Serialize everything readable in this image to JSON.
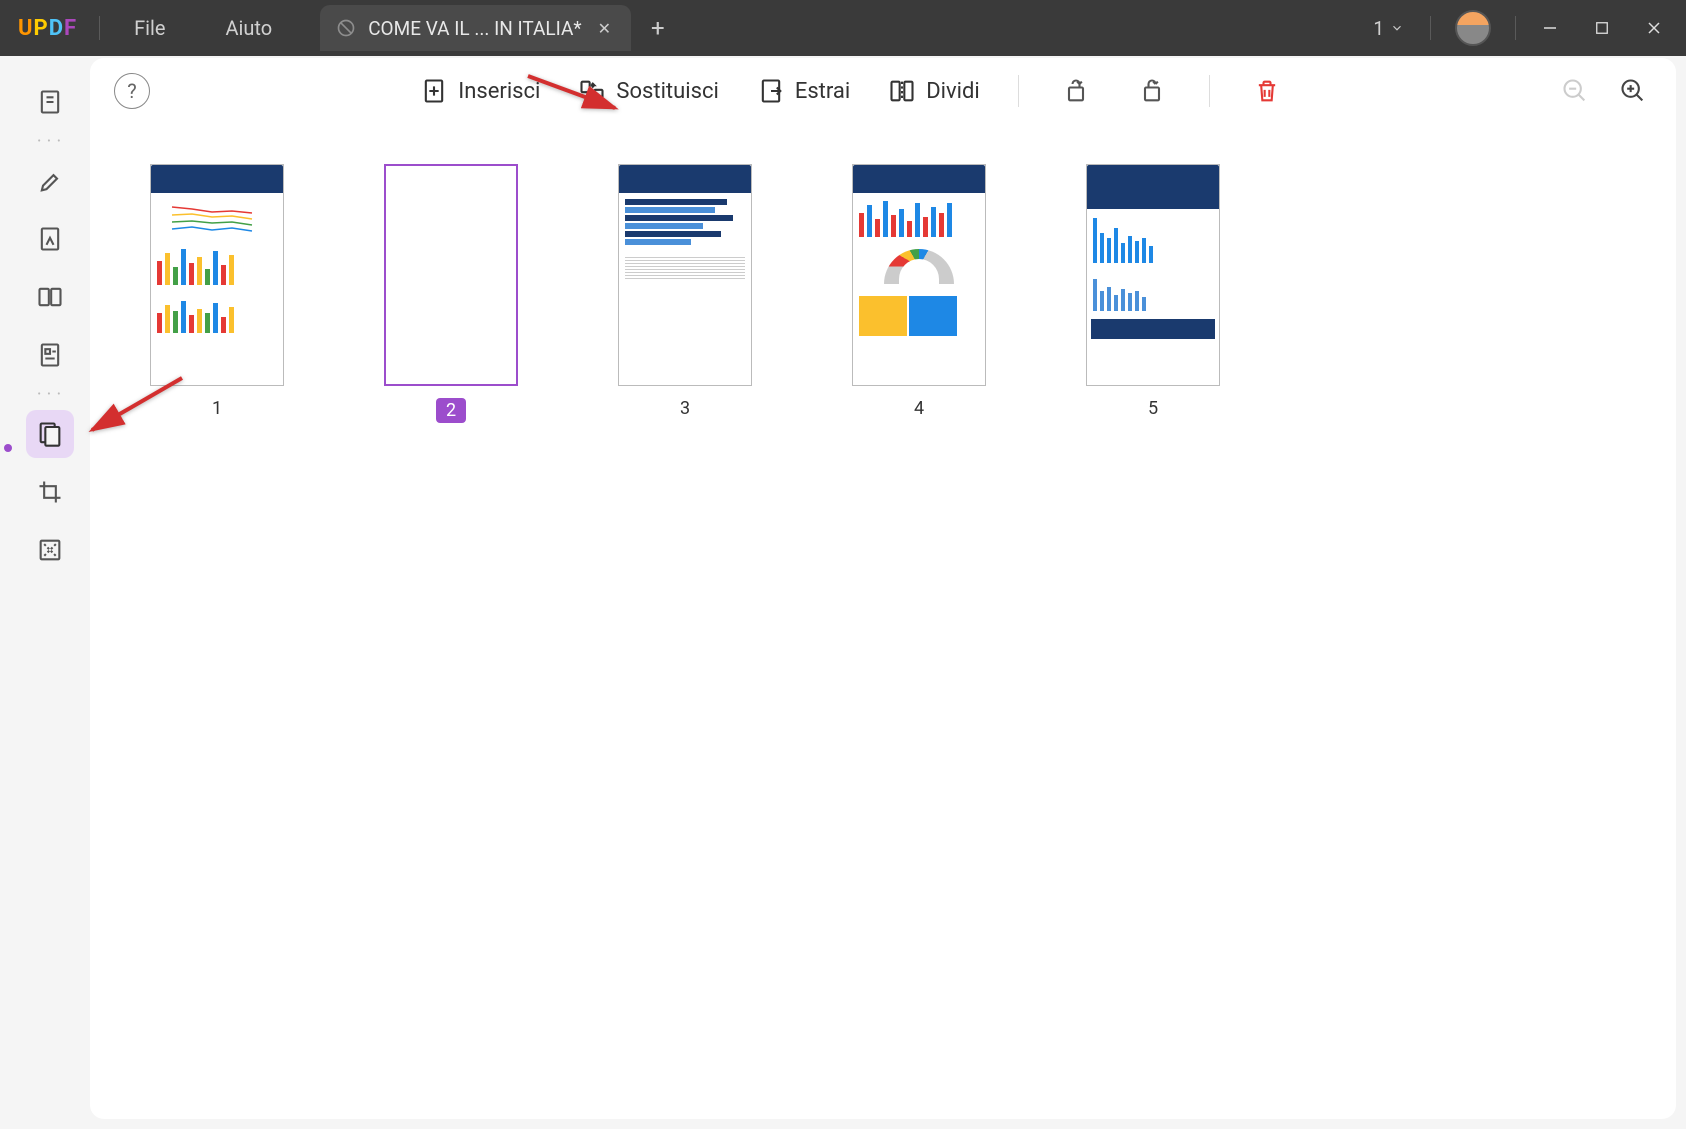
{
  "logo": "UPDF",
  "menus": {
    "file": "File",
    "help": "Aiuto"
  },
  "tab": {
    "title": "COME VA IL ... IN ITALIA*"
  },
  "page_indicator": "1",
  "toolbar": {
    "insert": "Inserisci",
    "replace": "Sostituisci",
    "extract": "Estrai",
    "split": "Dividi"
  },
  "thumbnails": [
    {
      "label": "1",
      "selected": false
    },
    {
      "label": "2",
      "selected": true
    },
    {
      "label": "3",
      "selected": false
    },
    {
      "label": "4",
      "selected": false
    },
    {
      "label": "5",
      "selected": false
    }
  ],
  "sidebar": {
    "items": [
      "reader",
      "highlight",
      "edit",
      "compare",
      "form",
      "organize",
      "crop",
      "redact"
    ],
    "active": "organize"
  }
}
